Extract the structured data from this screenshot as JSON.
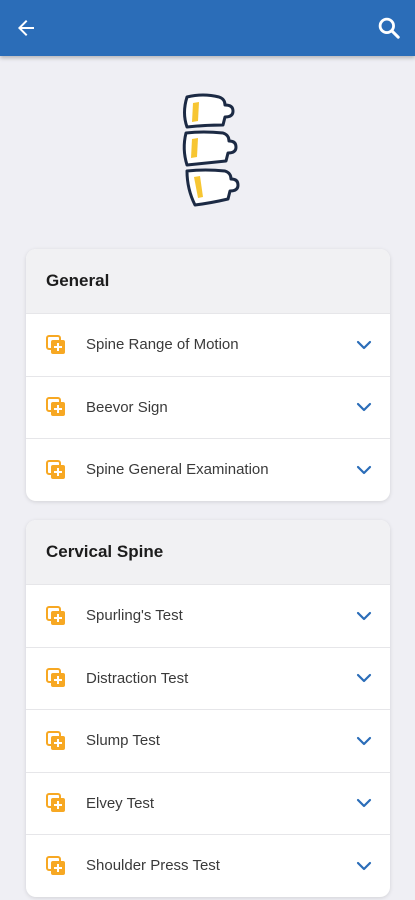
{
  "appbar": {
    "color": "#2b6db8",
    "back_icon": "arrow-left-icon",
    "search_icon": "search-icon"
  },
  "hero": {
    "icon": "spine-vertebrae-icon",
    "accent": "#f7c633",
    "stroke": "#1c2a44"
  },
  "sections": [
    {
      "title": "General",
      "items": [
        {
          "label": "Spine Range of Motion"
        },
        {
          "label": "Beevor Sign"
        },
        {
          "label": "Spine General Examination"
        }
      ]
    },
    {
      "title": "Cervical Spine",
      "items": [
        {
          "label": "Spurling's Test"
        },
        {
          "label": "Distraction Test"
        },
        {
          "label": "Slump Test"
        },
        {
          "label": "Elvey Test"
        },
        {
          "label": "Shoulder Press Test"
        }
      ]
    }
  ],
  "item_icon": "add-document-icon",
  "item_icon_color": "#f7a823",
  "chevron_icon": "chevron-down-icon",
  "chevron_color": "#2b6db8"
}
